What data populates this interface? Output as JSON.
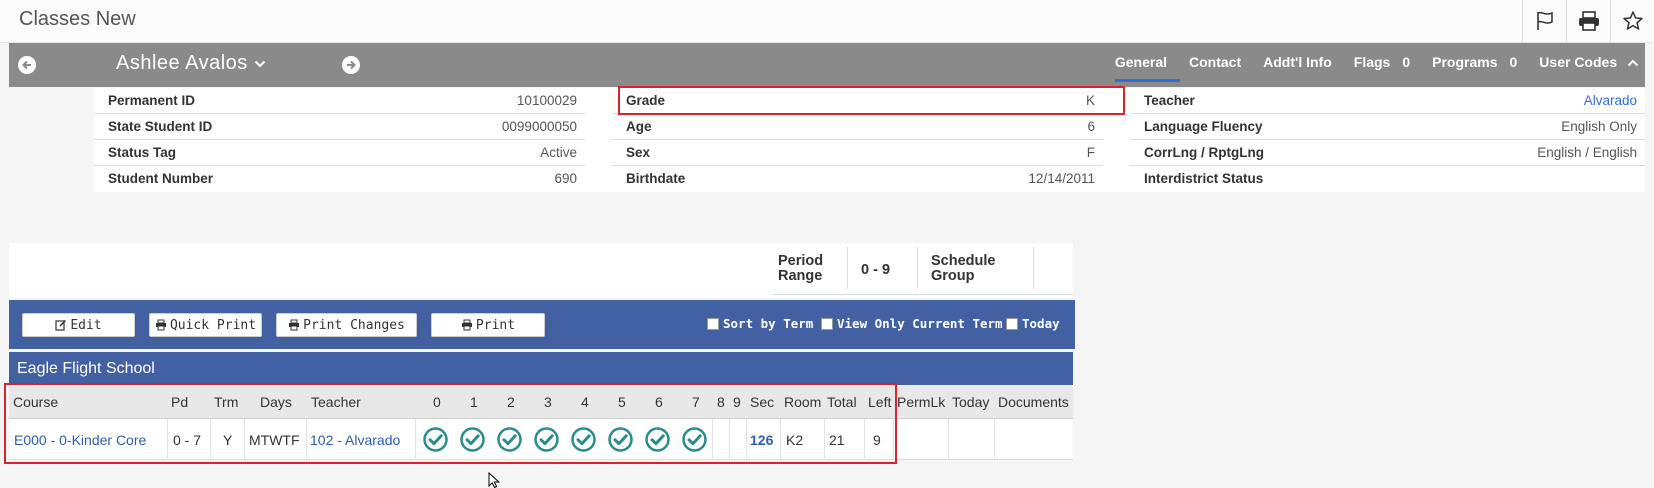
{
  "app": {
    "title": "Classes New"
  },
  "top_icons": [
    "flag-icon",
    "print-icon",
    "star-icon"
  ],
  "student": {
    "name": "Ashlee Avalos"
  },
  "tabs": [
    {
      "label": "General",
      "count": ""
    },
    {
      "label": "Contact",
      "count": ""
    },
    {
      "label": "Addt'l Info",
      "count": ""
    },
    {
      "label": "Flags",
      "count": "0"
    },
    {
      "label": "Programs",
      "count": "0"
    },
    {
      "label": "User Codes",
      "count": ""
    }
  ],
  "info": {
    "col1": [
      {
        "label": "Permanent ID",
        "value": "10100029"
      },
      {
        "label": "State Student ID",
        "value": "0099000050"
      },
      {
        "label": "Status Tag",
        "value": "Active"
      },
      {
        "label": "Student Number",
        "value": "690"
      }
    ],
    "col2": [
      {
        "label": "Grade",
        "value": "K"
      },
      {
        "label": "Age",
        "value": "6"
      },
      {
        "label": "Sex",
        "value": "F"
      },
      {
        "label": "Birthdate",
        "value": "12/14/2011"
      }
    ],
    "col3": [
      {
        "label": "Teacher",
        "value": "Alvarado"
      },
      {
        "label": "Language Fluency",
        "value": "English Only"
      },
      {
        "label": "CorrLng / RptgLng",
        "value": "English / English"
      },
      {
        "label": "Interdistrict Status",
        "value": ""
      }
    ]
  },
  "schedule": {
    "period_range_label": "Period Range",
    "period_range_value": "0 - 9",
    "schedule_group_label": "Schedule Group"
  },
  "toolbar": {
    "edit": "Edit",
    "quick_print": "Quick Print",
    "print_changes": "Print Changes",
    "print": "Print",
    "sort_by_term": "Sort by Term",
    "view_only_current_term": "View Only Current Term",
    "today": "Today"
  },
  "school": {
    "name": "Eagle Flight School"
  },
  "table": {
    "headers": [
      "Course",
      "Pd",
      "Trm",
      "Days",
      "Teacher",
      "0",
      "1",
      "2",
      "3",
      "4",
      "5",
      "6",
      "7",
      "8",
      "9",
      "Sec",
      "Room",
      "Total",
      "Left",
      "PermLk",
      "Today",
      "Documents"
    ],
    "row": {
      "course": "E000 - 0-Kinder Core",
      "pd": "0 - 7",
      "trm": "Y",
      "days": "MTWTF",
      "teacher": "102 - Alvarado",
      "periods_checked": [
        true,
        true,
        true,
        true,
        true,
        true,
        true,
        true,
        false,
        false
      ],
      "sec": "126",
      "room": "K2",
      "total": "21",
      "left": "9"
    }
  },
  "colors": {
    "accent_blue": "#4360a3",
    "student_bar": "#8a8a8a",
    "check_teal": "#2a8c8c",
    "highlight_red": "#d9232d"
  }
}
